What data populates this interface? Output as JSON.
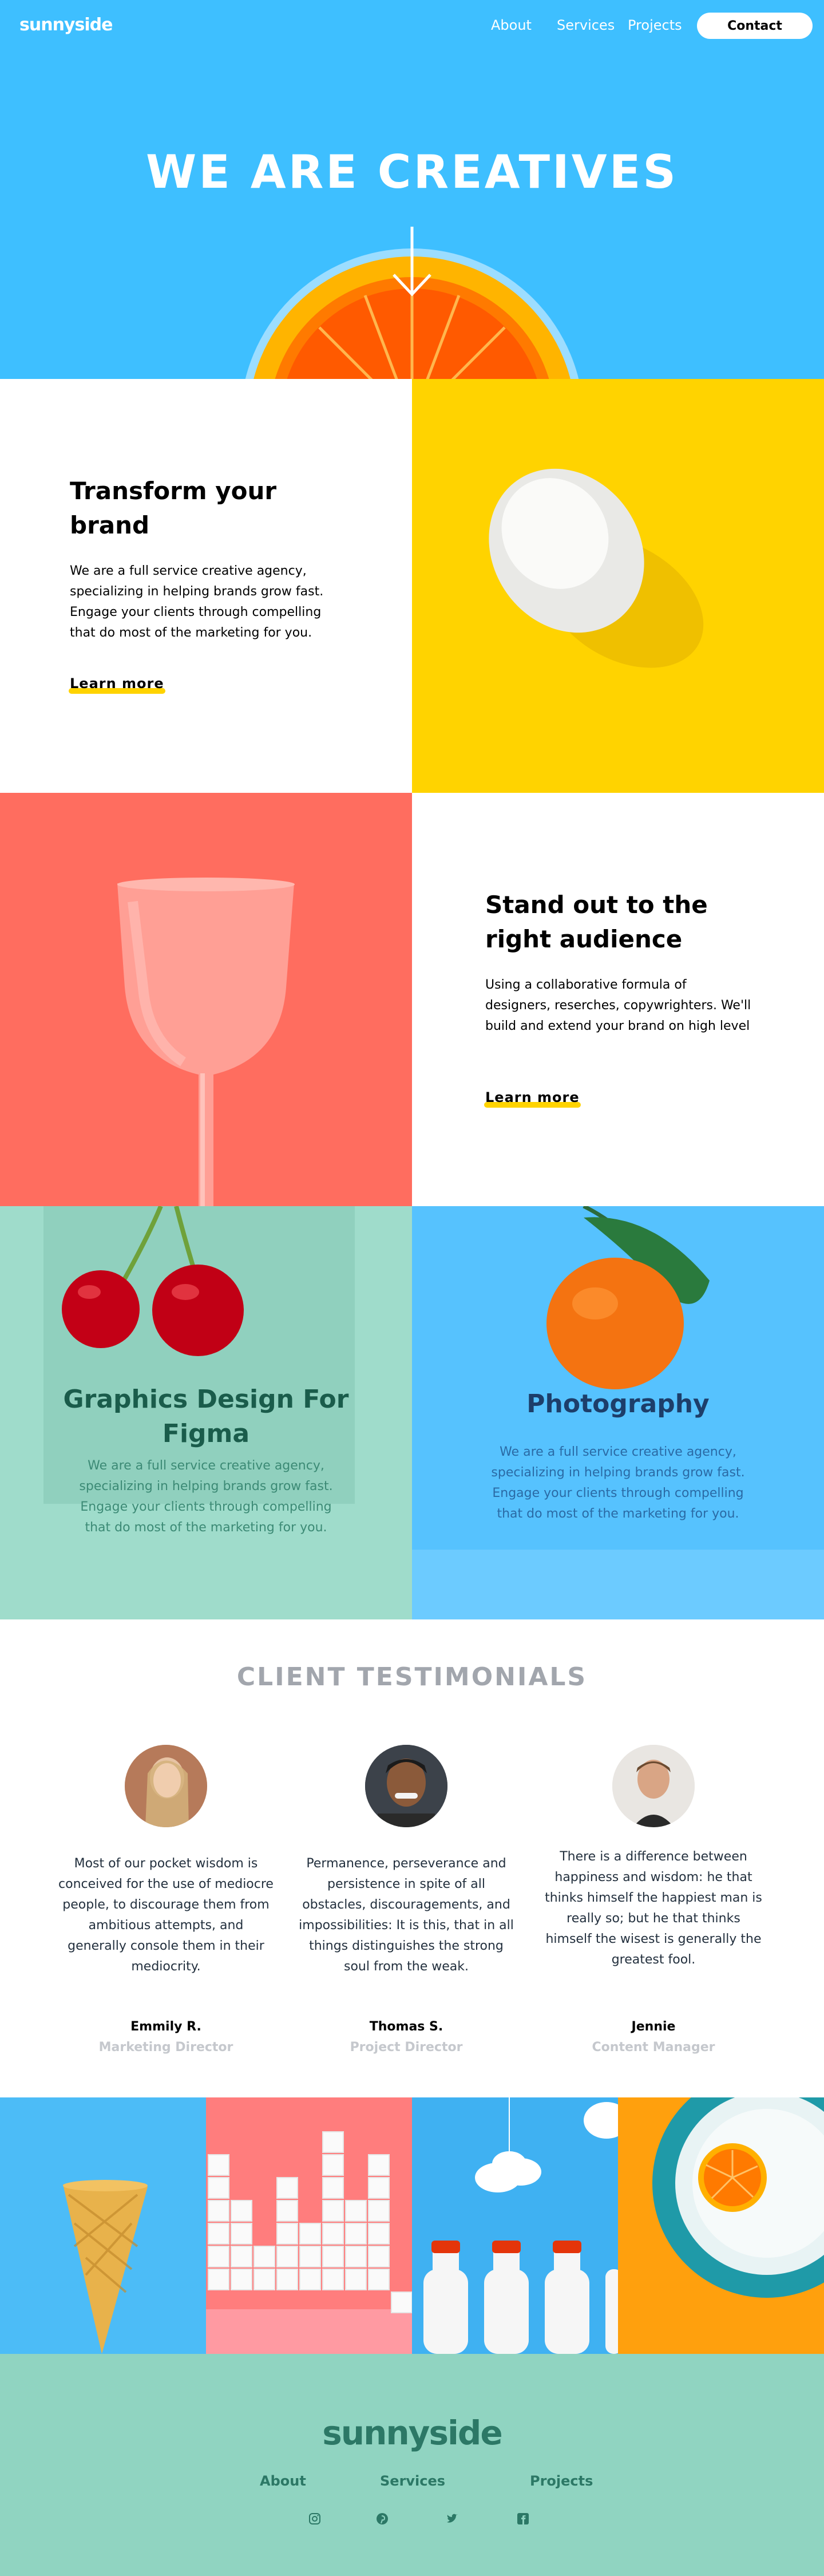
{
  "header": {
    "logo": "sunnyside",
    "nav": {
      "about": "About",
      "services": "Services",
      "projects": "Projects",
      "contact": "Contact"
    },
    "hero_title": "WE ARE CREATIVES"
  },
  "features": [
    {
      "title": "Transform your brand",
      "text": "We are a full service creative agency, specializing in helping brands grow fast. Engage your clients through compelling that do most of the marketing for you.",
      "link": "Learn more"
    },
    {
      "title": "Stand out to the right audience",
      "text": "Using a collaborative formula of designers, reserches, copywrighters. We'll build and extend your brand on high level",
      "link": "Learn more"
    }
  ],
  "cards": [
    {
      "title": "Graphics Design For Figma",
      "text": "We are a full service creative agency, specializing in helping brands grow fast. Engage your clients through compelling that do most of the marketing for you."
    },
    {
      "title": "Photography",
      "text": "We are a full service creative agency, specializing in helping brands grow fast. Engage your clients through compelling that do most of the marketing for you."
    }
  ],
  "testimonials": {
    "title": "CLIENT TESTIMONIALS",
    "items": [
      {
        "quote": "Most of our pocket wisdom is conceived for the use of mediocre people, to discourage them from ambitious attempts, and generally console them in their mediocrity.",
        "name": "Emmily R.",
        "role": "Marketing Director"
      },
      {
        "quote": "Permanence, perseverance and persistence in spite of all obstacles, discouragements, and impossibilities: It is this, that in all things distinguishes the strong soul from the weak.",
        "name": "Thomas S.",
        "role": "Project Director"
      },
      {
        "quote": "There is a difference between happiness and wisdom: he that thinks himself the happiest man is really so; but he that thinks himself the wisest is generally the greatest fool.",
        "name": "Jennie",
        "role": "Content Manager"
      }
    ]
  },
  "footer": {
    "logo": "sunnyside",
    "links": {
      "about": "About",
      "services": "Services",
      "projects": "Projects"
    },
    "social_icons": [
      "instagram-icon",
      "pinterest-icon",
      "twitter-icon",
      "facebook-icon"
    ]
  },
  "colors": {
    "hero_bg": "#3ebfff",
    "yellow": "#ffd300",
    "coral": "#ff6d5f",
    "mint": "#9fdccb",
    "sky": "#56c2fe",
    "footer_bg": "#90d4c1",
    "footer_text": "#2c7866"
  }
}
